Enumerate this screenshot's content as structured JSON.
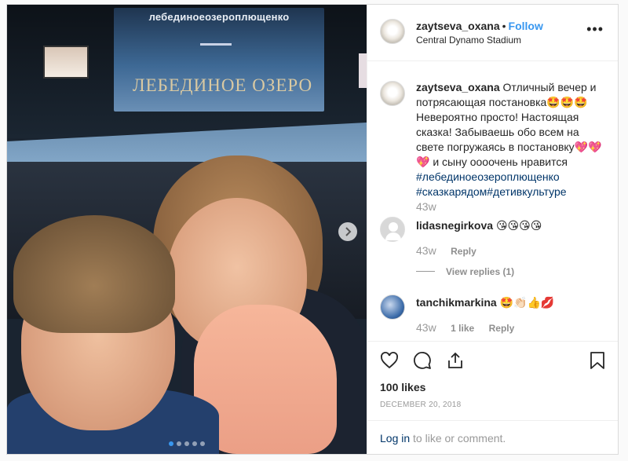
{
  "post": {
    "username": "zaytseva_oxana",
    "separator": "•",
    "follow_label": "Follow",
    "location": "Central Dynamo Stadium",
    "more_label": "•••"
  },
  "photo": {
    "banner_top": "лебединоеозероплющенко",
    "banner_title": "ЛЕБЕДИНОЕ ОЗЕРО",
    "next_label": "›",
    "carousel_count": 5,
    "carousel_active": 1,
    "accent": "#3897f0"
  },
  "caption": {
    "username": "zaytseva_oxana",
    "text": "Отличный вечер и потрясающая постановка🤩🤩🤩 Невероятно просто! Настоящая сказка! Забываешь обо всем на свете погружаясь в постановку💖💖💖 и сыну оооочень нравится",
    "hashtags": "#лебединоеозероплющенко #сказкарядом#детивкультуре",
    "time": "43w"
  },
  "comments": [
    {
      "username": "lidasnegirkova",
      "text": "😘😘😘😘",
      "time": "43w",
      "reply_label": "Reply",
      "view_replies": "View replies (1)"
    },
    {
      "username": "tanchikmarkina",
      "text": "🤩👏🏻👍💋",
      "time": "43w",
      "likes_label": "1 like",
      "reply_label": "Reply"
    }
  ],
  "actions": {
    "like_icon": "heart-icon",
    "comment_icon": "comment-icon",
    "share_icon": "share-icon",
    "save_icon": "bookmark-icon",
    "likes": "100 likes",
    "date": "DECEMBER 20, 2018",
    "login_link": "Log in",
    "login_suffix": " to like or comment."
  }
}
